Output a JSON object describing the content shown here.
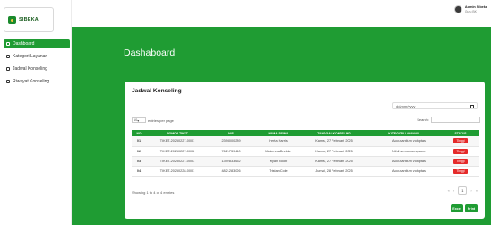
{
  "app": {
    "logo_text": "SIBEKA"
  },
  "user": {
    "name": "Admin Sibeka",
    "role": "Guru BK"
  },
  "sidebar": {
    "items": [
      {
        "label": "Dashboard",
        "icon": "grid-icon",
        "active": true
      },
      {
        "label": "Kategori Layanan",
        "icon": "tag-icon",
        "active": false
      },
      {
        "label": "Jadwal Konseling",
        "icon": "calendar-icon",
        "active": false
      },
      {
        "label": "Riwayat Konseling",
        "icon": "history-icon",
        "active": false
      }
    ]
  },
  "page": {
    "title": "Dashaboard"
  },
  "card": {
    "title": "Jadwal Konseling",
    "date_placeholder": "dd/mm/yyyy",
    "length_value": "10",
    "length_suffix": "entries per page",
    "search_label": "Search:",
    "columns": [
      "NO",
      "NOMOR TIKET",
      "NIS",
      "NAMA SISWA",
      "TANGGAL KONSELING",
      "KATEGORI LAYANAN",
      "STATUS"
    ],
    "rows": [
      {
        "no": "01",
        "tiket": "TIKET-20250227-0001",
        "nis": "2393000289",
        "nama": "Herta Harris",
        "tanggal": "Kamis, 27 Februari 2025",
        "kategori": "Accusantium voluptas.",
        "status": "Tinggi"
      },
      {
        "no": "02",
        "tiket": "TIKET-20250227-0002",
        "nis": "7621739440",
        "nama": "Makenna Brekke",
        "tanggal": "Kamis, 27 Februari 2025",
        "kategori": "Nihil nemo numquam.",
        "status": "Tinggi"
      },
      {
        "no": "03",
        "tiket": "TIKET-20250227-0003",
        "nis": "1392833652",
        "nama": "Myah Roob",
        "tanggal": "Kamis, 27 Februari 2025",
        "kategori": "Accusantium voluptas.",
        "status": "Tinggi"
      },
      {
        "no": "04",
        "tiket": "TIKET-20250228-0001",
        "nis": "4821283026",
        "nama": "Tristan Cole",
        "tanggal": "Jumat, 28 Februari 2025",
        "kategori": "Accusantium voluptas.",
        "status": "Tinggi"
      }
    ],
    "info": "Showing 1 to 4 of 4 entries",
    "pager": {
      "first": "«",
      "prev": "‹",
      "current": "1",
      "next": "›",
      "last": "»"
    },
    "buttons": {
      "excel": "Excel",
      "print": "Print"
    }
  },
  "colors": {
    "primary": "#1f9c33",
    "badge": "#e52b2b"
  }
}
